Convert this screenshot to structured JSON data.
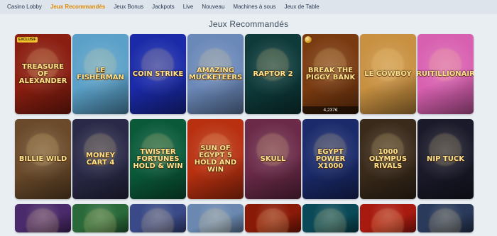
{
  "nav": {
    "items": [
      {
        "label": "Casino Lobby",
        "active": false
      },
      {
        "label": "Jeux Recommandés",
        "active": true
      },
      {
        "label": "Jeux Bonus",
        "active": false
      },
      {
        "label": "Jackpots",
        "active": false
      },
      {
        "label": "Live",
        "active": false
      },
      {
        "label": "Nouveau",
        "active": false
      },
      {
        "label": "Machines à sous",
        "active": false
      },
      {
        "label": "Jeux de Table",
        "active": false
      }
    ],
    "active_color": "#e08a00"
  },
  "section": {
    "title": "Jeux Recommandés"
  },
  "games": [
    {
      "title": "Treasure of Alexander",
      "badge": "EXCLUSIF",
      "bg": "#8a1e10"
    },
    {
      "title": "Le Fisherman",
      "bg": "#5aa0c8"
    },
    {
      "title": "Coin Strike",
      "bg": "#1a2aa8"
    },
    {
      "title": "Amazing Mucketeers",
      "bg": "#6a88b8"
    },
    {
      "title": "Raptor 2",
      "bg": "#0e3a3a"
    },
    {
      "title": "Break the Piggy Bank",
      "jackpot": "4,237€",
      "bg": "#7a3a10"
    },
    {
      "title": "Le Cowboy",
      "bg": "#c89040"
    },
    {
      "title": "Fruitillionaire",
      "bg": "#d860b0"
    },
    {
      "title": "Billie Wild",
      "bg": "#6a4a2a"
    },
    {
      "title": "Money Cart 4",
      "bg": "#2a2a48"
    },
    {
      "title": "Twister Fortunes Hold & Win",
      "bg": "#0a5a3a"
    },
    {
      "title": "Sun of Egypt 5 Hold and Win",
      "bg": "#b83010"
    },
    {
      "title": "Skull",
      "bg": "#6a2a48"
    },
    {
      "title": "Egypt Power x1000",
      "bg": "#1a2a6a"
    },
    {
      "title": "1000 Olympus Rivals",
      "bg": "#3a2a1a"
    },
    {
      "title": "Nip Tuck",
      "bg": "#1a1a2a"
    },
    {
      "title": "",
      "bg": "#4a2a6a"
    },
    {
      "title": "",
      "bg": "#2a6a3a"
    },
    {
      "title": "",
      "bg": "#3a4a88"
    },
    {
      "title": "",
      "bg": "#6a88b0"
    },
    {
      "title": "",
      "bg": "#8a1a08"
    },
    {
      "title": "",
      "bg": "#0a4a58"
    },
    {
      "title": "",
      "bg": "#a81a10"
    },
    {
      "title": "",
      "bg": "#2a3a5a"
    }
  ]
}
